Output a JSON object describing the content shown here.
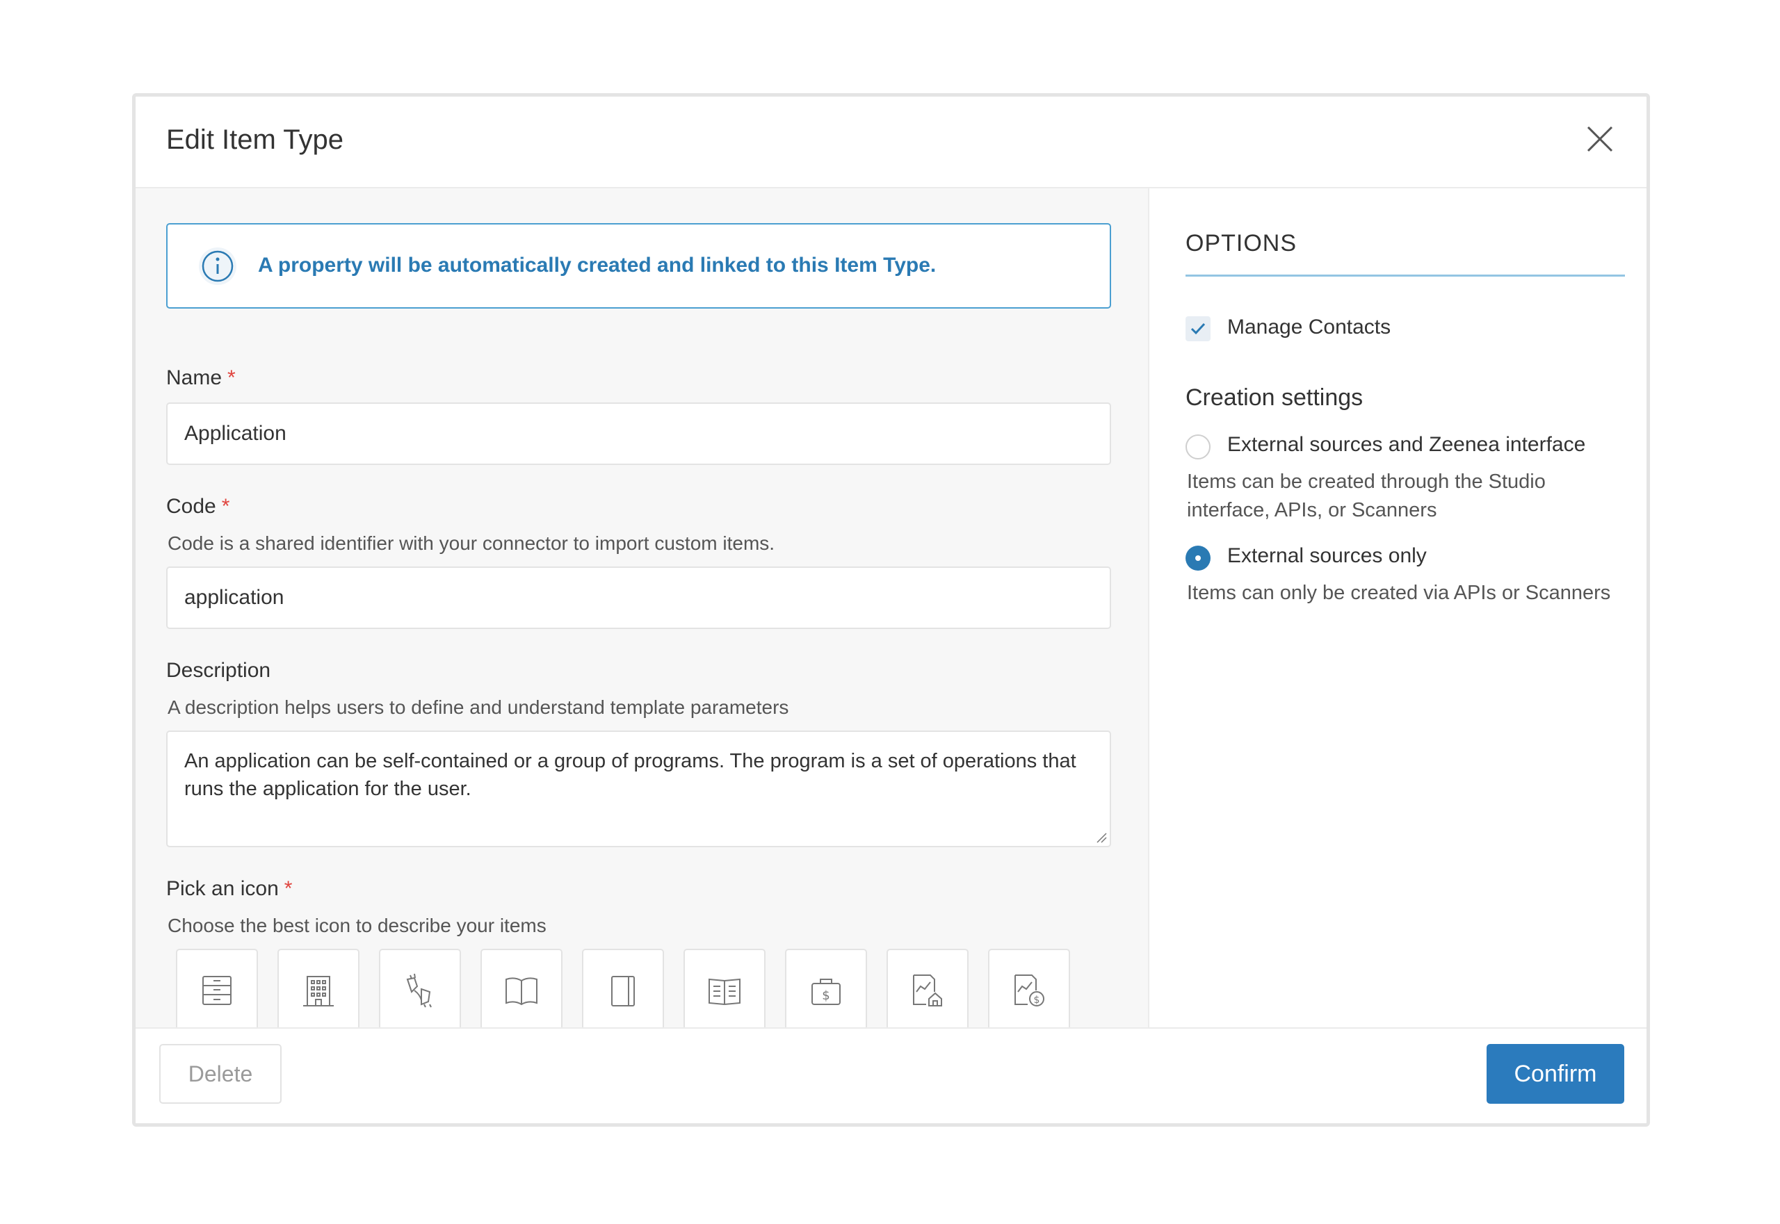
{
  "dialog": {
    "title": "Edit Item Type"
  },
  "info": {
    "message": "A property will be automatically created and linked to this Item Type."
  },
  "form": {
    "name": {
      "label": "Name",
      "required_mark": "*",
      "value": "Application"
    },
    "code": {
      "label": "Code",
      "required_mark": "*",
      "help": "Code is a shared identifier with your connector to import custom items.",
      "value": "application"
    },
    "description": {
      "label": "Description",
      "help": "A description helps users to define and understand template parameters",
      "value": "An application can be self-contained or a group of programs. The program is a set of operations that runs the application for the user."
    },
    "icon": {
      "label": "Pick an icon",
      "required_mark": "*",
      "help": "Choose the best icon to describe your items"
    }
  },
  "icons": [
    "archive-drawers-icon",
    "building-icon",
    "plug-connector-icon",
    "open-book-icon",
    "notebook-icon",
    "open-book-text-icon",
    "money-bag-icon",
    "chart-document-home-icon",
    "chart-document-dollar-icon"
  ],
  "options": {
    "title": "OPTIONS",
    "manage_contacts": {
      "label": "Manage Contacts",
      "checked": true
    },
    "creation_settings": {
      "title": "Creation settings",
      "choices": [
        {
          "label": "External sources and Zeenea interface",
          "help": "Items can be created through the Studio interface, APIs, or Scanners",
          "selected": false
        },
        {
          "label": "External sources only",
          "help": "Items can only be created via APIs or Scanners",
          "selected": true
        }
      ]
    }
  },
  "footer": {
    "delete_label": "Delete",
    "confirm_label": "Confirm"
  },
  "colors": {
    "accent": "#2b7bbd",
    "info_border": "#4b9fd1",
    "required": "#e0443e"
  }
}
